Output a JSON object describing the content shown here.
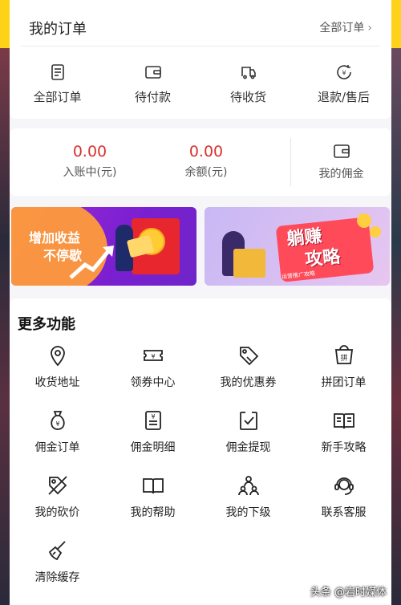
{
  "orders": {
    "title": "我的订单",
    "view_all": "全部订单",
    "items": [
      {
        "label": "全部订单",
        "icon": "document-icon"
      },
      {
        "label": "待付款",
        "icon": "wallet-icon"
      },
      {
        "label": "待收货",
        "icon": "truck-icon"
      },
      {
        "label": "退款/售后",
        "icon": "refund-icon"
      }
    ]
  },
  "wallet": {
    "pending_amount": "0.00",
    "pending_label": "入账中(元)",
    "balance_amount": "0.00",
    "balance_label": "余额(元)",
    "commission_label": "我的佣金"
  },
  "banners": {
    "left_line1": "增加收益",
    "left_line2": "不停歇",
    "right_line1": "躺赚",
    "right_line2": "攻略",
    "right_small": "运营推广攻略"
  },
  "more": {
    "title": "更多功能",
    "items": [
      {
        "label": "收货地址",
        "icon": "location-pin-icon"
      },
      {
        "label": "领券中心",
        "icon": "ticket-icon"
      },
      {
        "label": "我的优惠券",
        "icon": "coupon-tag-icon"
      },
      {
        "label": "拼团订单",
        "icon": "group-order-icon"
      },
      {
        "label": "佣金订单",
        "icon": "money-bag-icon"
      },
      {
        "label": "佣金明细",
        "icon": "receipt-icon"
      },
      {
        "label": "佣金提现",
        "icon": "withdraw-icon"
      },
      {
        "label": "新手攻略",
        "icon": "book-guide-icon"
      },
      {
        "label": "我的砍价",
        "icon": "bargain-icon"
      },
      {
        "label": "我的帮助",
        "icon": "help-book-icon"
      },
      {
        "label": "我的下级",
        "icon": "team-icon"
      },
      {
        "label": "联系客服",
        "icon": "customer-service-icon"
      },
      {
        "label": "清除缓存",
        "icon": "broom-icon"
      }
    ]
  },
  "watermark": "头条 @岩时媒体",
  "colors": {
    "accent_yellow": "#ffd21a",
    "money_red": "#d9312f"
  }
}
